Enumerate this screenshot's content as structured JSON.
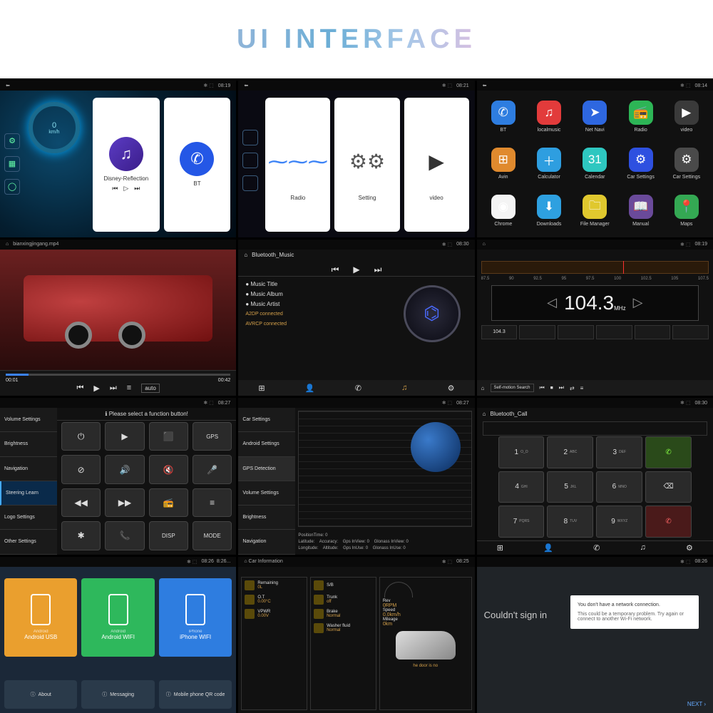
{
  "title": "UI INTERFACE",
  "p1": {
    "time": "08:19",
    "speed_val": "0",
    "speed_unit": "km/h",
    "card1_label": "Disney-Reflection",
    "card2_label": "BT"
  },
  "p2": {
    "time": "08:21",
    "tile1": "Radio",
    "tile2": "Setting",
    "tile3": "video"
  },
  "p3": {
    "time": "08:14",
    "apps": [
      {
        "label": "BT",
        "color": "#2e7de0",
        "glyph": "✆"
      },
      {
        "label": "localmusic",
        "color": "#e23b3b",
        "glyph": "♫"
      },
      {
        "label": "Net Navi",
        "color": "#2e67e0",
        "glyph": "➤"
      },
      {
        "label": "Radio",
        "color": "#2db556",
        "glyph": "📻"
      },
      {
        "label": "video",
        "color": "#3a3a3a",
        "glyph": "▶"
      },
      {
        "label": "Avin",
        "color": "#e08a2e",
        "glyph": "⊞"
      },
      {
        "label": "Calculator",
        "color": "#2e9ee0",
        "glyph": "＋"
      },
      {
        "label": "Calendar",
        "color": "#2ec7c0",
        "glyph": "31"
      },
      {
        "label": "Car Settings",
        "color": "#2e50e0",
        "glyph": "⚙"
      },
      {
        "label": "Car Settings",
        "color": "#4a4a4a",
        "glyph": "⚙"
      },
      {
        "label": "Chrome",
        "color": "#f4f4f4",
        "glyph": "◉"
      },
      {
        "label": "Downloads",
        "color": "#2ea0e0",
        "glyph": "⬇"
      },
      {
        "label": "File Manager",
        "color": "#e0c82e",
        "glyph": "🗀"
      },
      {
        "label": "Manual",
        "color": "#6a4a9a",
        "glyph": "📖"
      },
      {
        "label": "Maps",
        "color": "#34a853",
        "glyph": "📍"
      }
    ]
  },
  "p4": {
    "file": "bianxingjingang.mp4",
    "time_now": "00:01",
    "time_total": "00:42",
    "auto": "auto"
  },
  "p5": {
    "time": "08:30",
    "screen": "Bluetooth_Music",
    "meta": [
      "Music Title",
      "Music Album",
      "Music Artist"
    ],
    "status": [
      "A2DP connected",
      "AVRCP connected"
    ]
  },
  "p6": {
    "time": "08:19",
    "ticks": [
      "87.5",
      "90",
      "92.5",
      "95",
      "97.5",
      "100",
      "102.5",
      "105",
      "107.5"
    ],
    "freq": "104.3",
    "unit": "MHz",
    "preset": "104.3",
    "search": "Self-motion Search"
  },
  "p7": {
    "time": "08:27",
    "title": "Please select a function button!",
    "menu": [
      "Volume Settings",
      "Brightness",
      "Navigation",
      "Steering Learn",
      "Logo Settings",
      "Other Settings"
    ],
    "menu_sel": 3,
    "btns": [
      "⏻",
      "▶",
      "⬛",
      "GPS",
      "⊘",
      "🔊",
      "🔇",
      "🎤",
      "◀◀",
      "▶▶",
      "📻",
      "≡",
      "✱",
      "📞",
      "DISP",
      "MODE"
    ]
  },
  "p8": {
    "time": "08:27",
    "menu": [
      "Car Settings",
      "Android Settings",
      "GPS Detection",
      "Volume Settings",
      "Brightness",
      "Navigation"
    ],
    "menu_sel": 2,
    "info": {
      "pt": "PositionTime: 0",
      "lat": "Latitude:",
      "lon": "Longitude:",
      "acc": "Accuracy:",
      "alt": "Altitude:",
      "gv": "Gps InView: 0",
      "gu": "Gps InUse: 0",
      "gnv": "Glonass InView: 0",
      "gnu": "Glonass InUse: 0"
    }
  },
  "p9": {
    "time": "08:30",
    "screen": "Bluetooth_Call",
    "keys": [
      {
        "main": "1",
        "sub": "O_O"
      },
      {
        "main": "2",
        "sub": "ABC"
      },
      {
        "main": "3",
        "sub": "DEF"
      },
      {
        "main": "✆",
        "cls": "call"
      },
      {
        "main": "4",
        "sub": "GHI"
      },
      {
        "main": "5",
        "sub": "JKL"
      },
      {
        "main": "6",
        "sub": "MNO"
      },
      {
        "main": "⌫",
        "cls": ""
      },
      {
        "main": "7",
        "sub": "PQRS"
      },
      {
        "main": "8",
        "sub": "TUV"
      },
      {
        "main": "9",
        "sub": "WXYZ"
      },
      {
        "main": "✆",
        "cls": "end"
      }
    ]
  },
  "p10": {
    "time": "08:26",
    "alt_time": "8:26...",
    "tiles": [
      {
        "label": "Android USB",
        "sub": "Android",
        "color": "#ea9f2e"
      },
      {
        "label": "Android WIFI",
        "sub": "Android",
        "color": "#2eb85c"
      },
      {
        "label": "iPhone WIFI",
        "sub": "iPhone",
        "color": "#2e7de0"
      }
    ],
    "bottom": [
      "About",
      "Messaging",
      "Mobile phone QR code"
    ]
  },
  "p11": {
    "time": "08:25",
    "screen": "Car Information",
    "left": [
      {
        "label": "Remaining",
        "val": "0L"
      },
      {
        "label": "O.T",
        "val": "0.00°C"
      },
      {
        "label": "VPWR",
        "val": "0.00V"
      }
    ],
    "mid": [
      {
        "label": "S/B",
        "val": ""
      },
      {
        "label": "Trunk",
        "val": "off"
      },
      {
        "label": "Brake",
        "val": "Normal"
      },
      {
        "label": "Washer fluid",
        "val": "Normal"
      }
    ],
    "right": [
      {
        "label": "Rev",
        "val": "0RPM"
      },
      {
        "label": "Speed",
        "val": "0.0km/h"
      },
      {
        "label": "Mileage",
        "val": "0km"
      }
    ],
    "warn": "he door is no"
  },
  "p12": {
    "time": "08:26",
    "side": "Couldn't sign in",
    "msg1": "You don't have a network connection.",
    "msg2": "This could be a temporary problem. Try again or connect to another Wi-Fi network.",
    "next": "NEXT ›"
  }
}
